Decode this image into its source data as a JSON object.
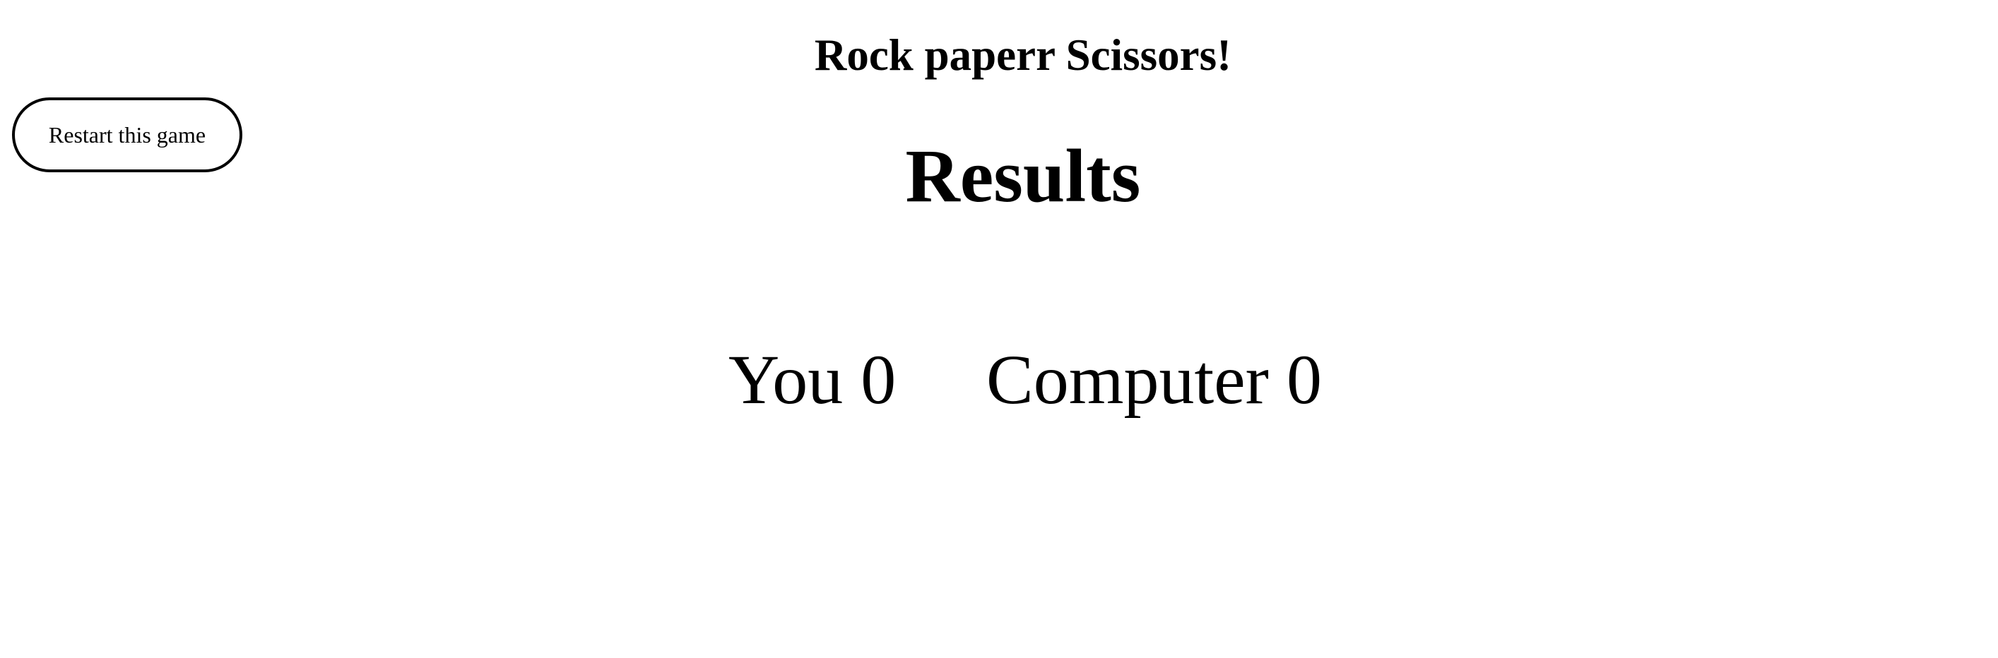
{
  "header": {
    "title": "Rock paperr Scissors!"
  },
  "controls": {
    "restart_label": "Restart this game"
  },
  "results": {
    "heading": "Results",
    "you_label": "You",
    "you_score": "0",
    "computer_label": "Computer",
    "computer_score": "0"
  }
}
